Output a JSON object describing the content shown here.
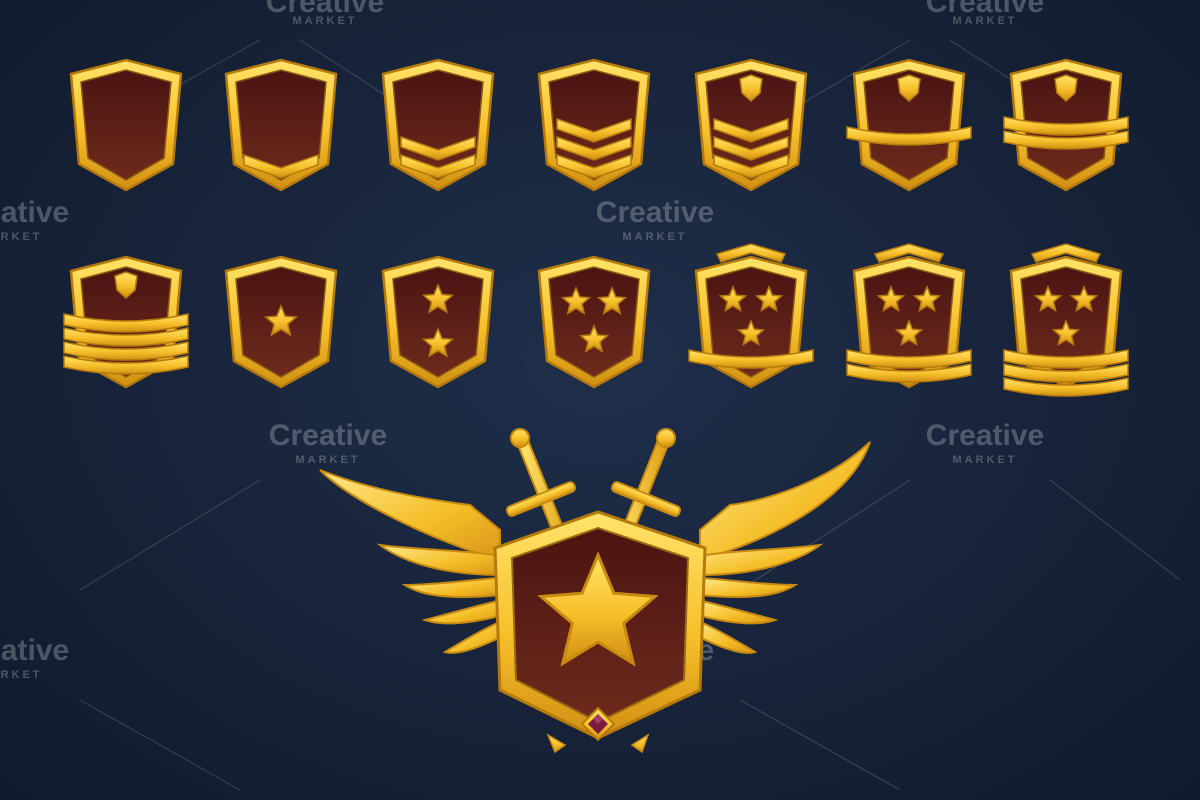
{
  "watermark": {
    "brand": "Creative",
    "sub": "MARKET"
  },
  "colors": {
    "background": "#17233a",
    "gold_light": "#ffe46a",
    "gold_mid": "#f7bf2a",
    "gold_dark": "#c98a10",
    "inner_top": "#4a1412",
    "inner_bottom": "#6e2a1c",
    "gem": "#7a1a3e"
  },
  "badges": [
    {
      "id": "rank-1",
      "type": "plain"
    },
    {
      "id": "rank-2",
      "type": "chevrons",
      "chevrons": 1
    },
    {
      "id": "rank-3",
      "type": "chevrons",
      "chevrons": 2
    },
    {
      "id": "rank-4",
      "type": "chevrons",
      "chevrons": 3
    },
    {
      "id": "rank-5",
      "type": "shield-chevrons",
      "chevrons": 3
    },
    {
      "id": "rank-6",
      "type": "shield-bands",
      "bands": 1
    },
    {
      "id": "rank-7",
      "type": "shield-bands",
      "bands": 2
    },
    {
      "id": "rank-8",
      "type": "shield-bands",
      "bands": 4
    },
    {
      "id": "rank-9",
      "type": "stars",
      "stars": 1
    },
    {
      "id": "rank-10",
      "type": "stars",
      "stars": 2
    },
    {
      "id": "rank-11",
      "type": "stars",
      "stars": 3
    },
    {
      "id": "rank-12",
      "type": "stars-crown",
      "stars": 3,
      "bands": 1
    },
    {
      "id": "rank-13",
      "type": "stars-crown",
      "stars": 3,
      "bands": 2
    },
    {
      "id": "rank-14",
      "type": "stars-crown",
      "stars": 3,
      "bands": 3
    }
  ],
  "emblem": {
    "id": "winged-star-emblem",
    "swords": 2,
    "wings": 2,
    "star": 1,
    "gem": 1
  }
}
